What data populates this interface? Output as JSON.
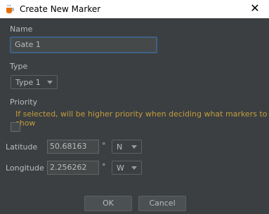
{
  "window": {
    "title": "Create New Marker",
    "icon": "java-coffee-icon",
    "close_glyph": "✕"
  },
  "form": {
    "name_label": "Name",
    "name_value": "Gate 1",
    "type_label": "Type",
    "type_value": "Type 1",
    "priority_label": "Priority",
    "priority_hint": "If selected, will be higher priority when deciding what markers to show",
    "priority_checked": false,
    "latitude_label": "Latitude",
    "latitude_value": "50.68163",
    "latitude_unit": "°",
    "latitude_dir": "N",
    "longitude_label": "Longitude",
    "longitude_value": "2.256262",
    "longitude_unit": "°",
    "longitude_dir": "W"
  },
  "buttons": {
    "ok": "OK",
    "cancel": "Cancel"
  },
  "colors": {
    "background": "#3c3f41",
    "hint": "#c29c3e",
    "focus_border": "#3d6185"
  }
}
